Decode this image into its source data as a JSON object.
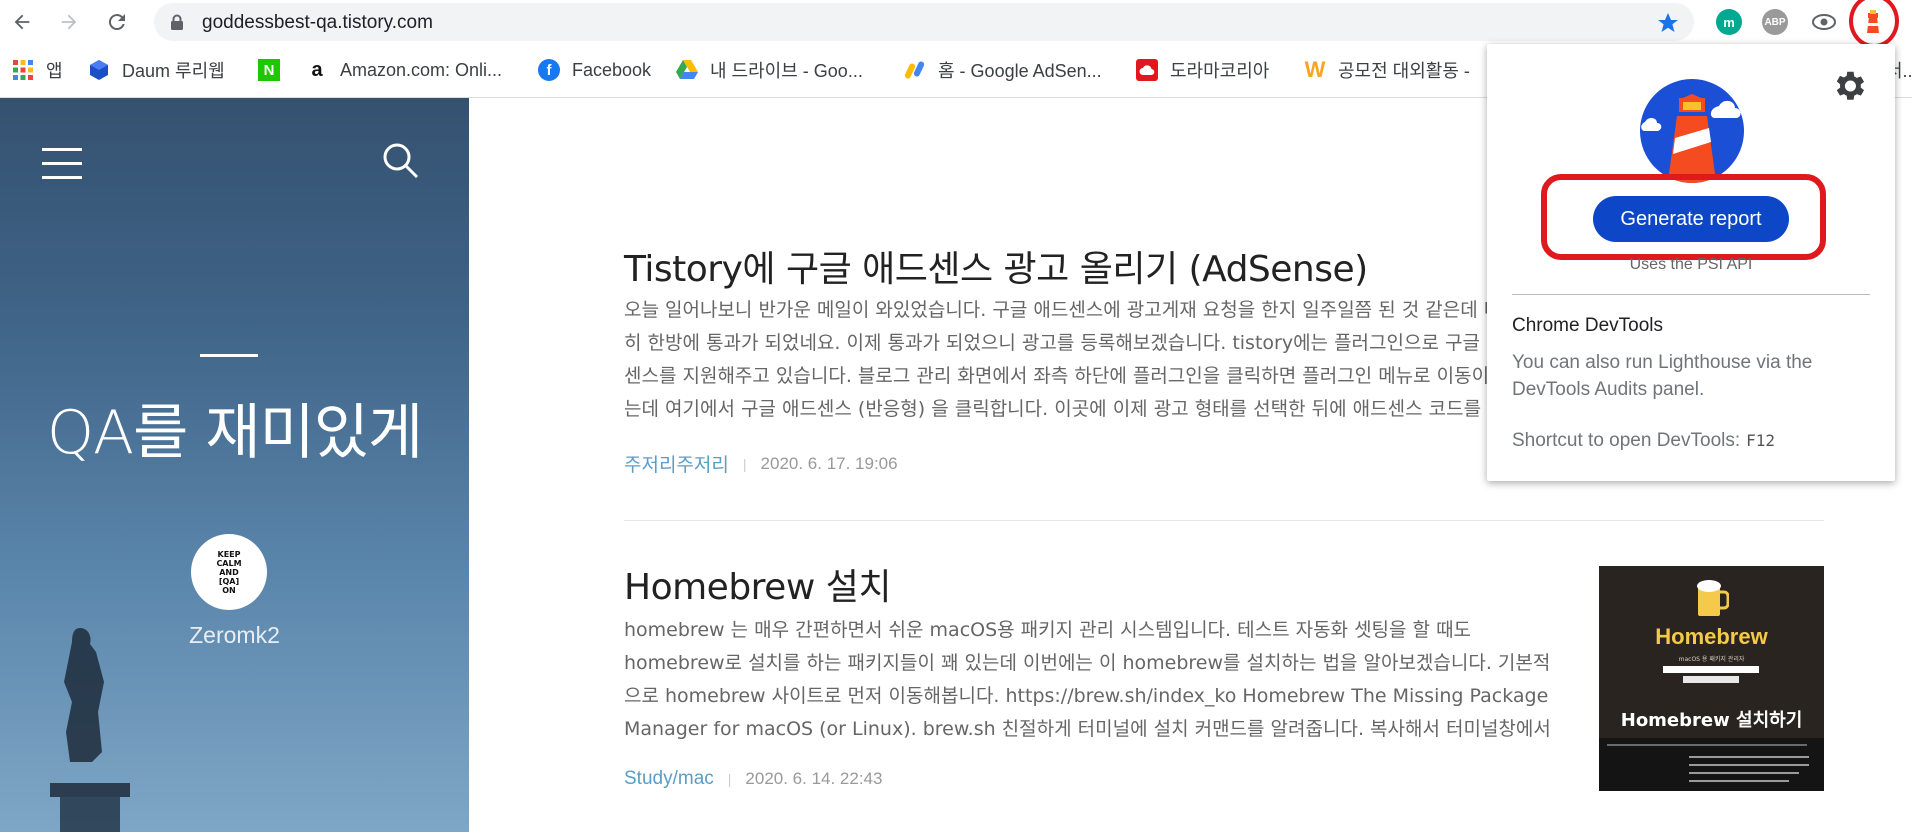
{
  "browser": {
    "url": "goddessbest-qa.tistory.com",
    "extensions": [
      {
        "name": "m",
        "color": "#00a98f"
      },
      {
        "name": "ABP",
        "color": "#9a9a9a"
      },
      {
        "name": "eye-extension-icon",
        "color": "#5f6368"
      },
      {
        "name": "lighthouse-icon",
        "color": "#f44b21"
      }
    ]
  },
  "bookmarks": [
    {
      "label": "앱",
      "icon": "apps-grid-icon",
      "color": "#e8453c"
    },
    {
      "label": "Daum 루리웹",
      "icon": "cube-icon",
      "color": "#1a4fc8"
    },
    {
      "label": "",
      "icon": "N",
      "color": "#1ec800"
    },
    {
      "label": "Amazon.com: Onli...",
      "icon": "a",
      "color": "#111111"
    },
    {
      "label": "Facebook",
      "icon": "f",
      "color": "#1877f2"
    },
    {
      "label": "내 드라이브 - Goo...",
      "icon": "drive-icon",
      "color": "#34a853"
    },
    {
      "label": "홈 - Google AdSen...",
      "icon": "adsense-icon",
      "color": "#fbbc04"
    },
    {
      "label": "도라마코리아",
      "icon": "cloud-icon",
      "color": "#e0191f"
    },
    {
      "label": "공모전 대외활동 -",
      "icon": "W",
      "color": "#f6a623"
    }
  ],
  "bookmark_tail": "서...",
  "sidebar": {
    "blog_title": "QA를 재미있게",
    "author": "Zeromk2",
    "avatar_text": [
      "KEEP",
      "CALM",
      "AND",
      "[QA]",
      "ON"
    ]
  },
  "posts": [
    {
      "title": "Tistory에 구글 애드센스 광고 올리기 (AdSense)",
      "excerpt": "오늘 일어나보니 반가운 메일이 와있었습니다. 구글 애드센스에 광고게재 요청을 한지 일주일쯤 된 것 같은데 다행히 한방에 통과가 되었네요. 이제 통과가 되었으니 광고를 등록해보겠습니다. tistory에는 플러그인으로 구글 애드센스를 지원해주고 있습니다. 블로그 관리 화면에서 좌측 하단에 플러그인을 클릭하면 플러그인 메뉴로 이동이 되는데 여기에서 구글 애드센스 (반응형) 을 클릭합니다. 이곳에 이제 광고 형태를 선택한 뒤에 애드센스 코드를 입력하게 됩니다.",
      "category": "주저리주저리",
      "date": "2020. 6. 17. 19:06"
    },
    {
      "title": "Homebrew 설치",
      "excerpt": "homebrew 는 매우 간편하면서 쉬운 macOS용 패키지 관리 시스템입니다. 테스트 자동화 셋팅을 할 때도 homebrew로 설치를 하는 패키지들이 꽤 있는데 이번에는 이 homebrew를 설치하는 법을 알아보겠습니다. 기본적으로 homebrew 사이트로 먼저 이동해봅니다. https://brew.sh/index_ko Homebrew The Missing Package Manager for macOS (or Linux). brew.sh 친절하게 터미널에 설치 커맨드를 알려줍니다. 복사해서 터미널창에서 실행해봅시…",
      "category": "Study/mac",
      "date": "2020. 6. 14. 22:43",
      "thumbnail": {
        "brand": "Homebrew",
        "subtitle": "macOS 용 패키지 관리자",
        "heading": "Homebrew 설치하기"
      }
    }
  ],
  "lighthouse_popup": {
    "button_label": "Generate report",
    "psi_note": "Uses the PSI API",
    "devtools_title": "Chrome DevTools",
    "devtools_text": "You can also run Lighthouse via the DevTools Audits panel.",
    "shortcut_label": "Shortcut to open DevTools:",
    "shortcut_key": "F12",
    "highlight_color": "#e0191f",
    "button_color": "#0d47c7"
  }
}
